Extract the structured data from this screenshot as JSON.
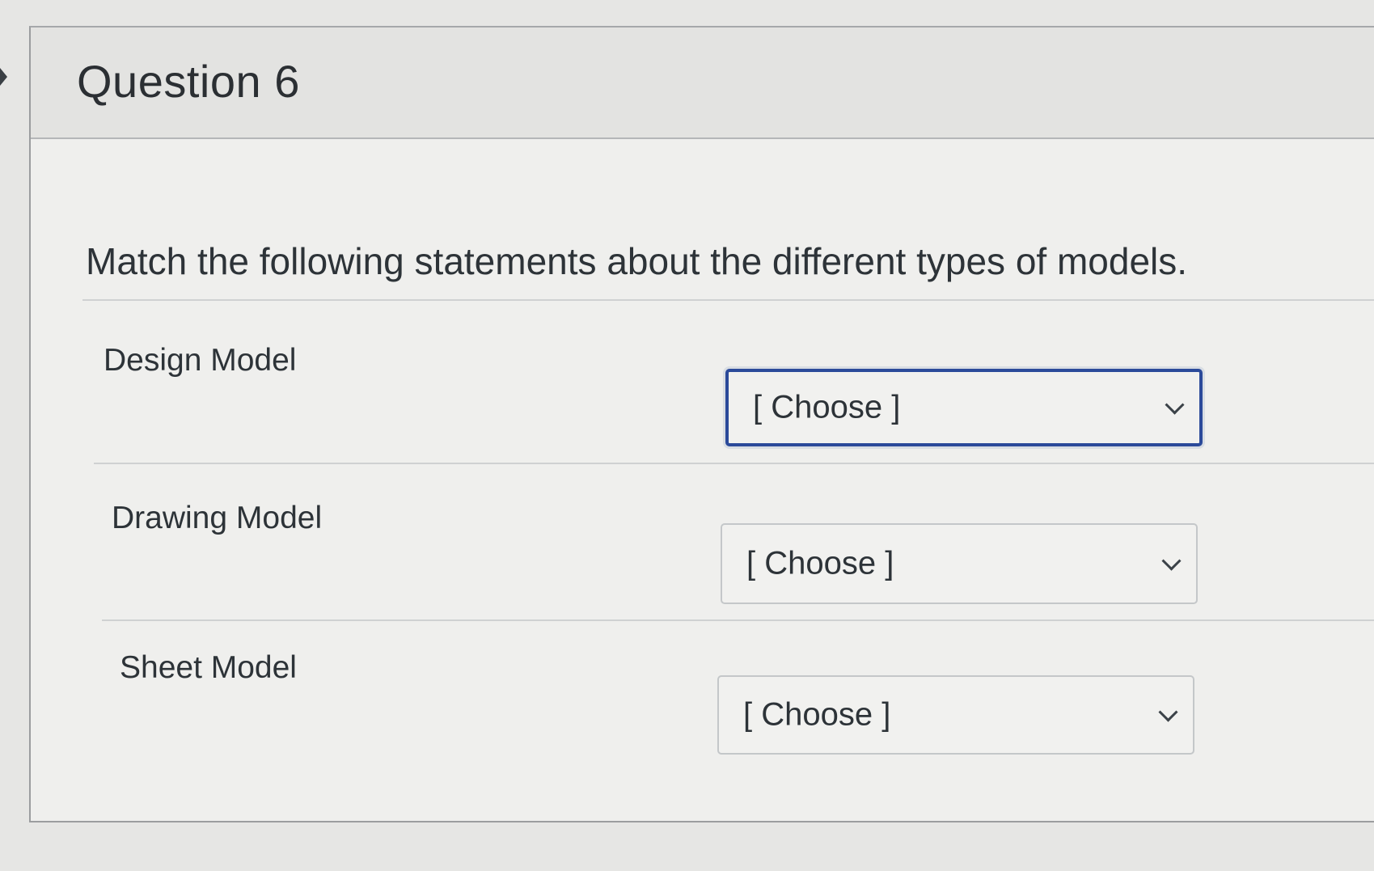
{
  "question": {
    "title": "Question 6",
    "prompt": "Match the following statements about the different types of models."
  },
  "matches": [
    {
      "label": "Design Model",
      "selected": "[ Choose ]",
      "focused": true
    },
    {
      "label": "Drawing Model",
      "selected": "[ Choose ]",
      "focused": false
    },
    {
      "label": "Sheet Model",
      "selected": "[ Choose ]",
      "focused": false
    }
  ],
  "icons": {
    "select_arrow": "chevron-down-icon",
    "side_toggle": "chevron-right-icon"
  },
  "colors": {
    "focus_border": "#2b4a9a",
    "card_background": "#efefed",
    "header_background": "#e3e3e1"
  }
}
